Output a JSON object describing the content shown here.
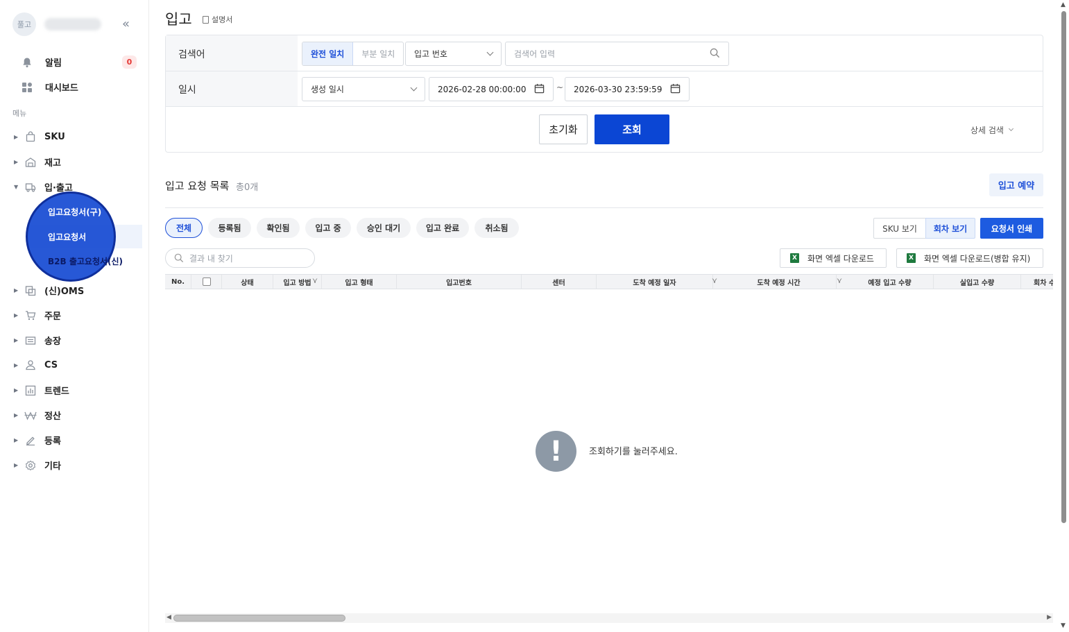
{
  "sidebar": {
    "avatar_text": "풀고",
    "collapse_icon": "«",
    "alert_label": "알림",
    "alert_count": "0",
    "dashboard_label": "대시보드",
    "menu_caption": "메뉴",
    "nav": [
      {
        "label": "SKU",
        "icon": "bag-icon"
      },
      {
        "label": "재고",
        "icon": "warehouse-icon"
      },
      {
        "label": "입·출고",
        "icon": "truck-icon"
      },
      {
        "label": "(신)OMS",
        "icon": "oms-icon"
      },
      {
        "label": "주문",
        "icon": "cart-icon"
      },
      {
        "label": "송장",
        "icon": "invoice-icon"
      },
      {
        "label": "CS",
        "icon": "person-icon"
      },
      {
        "label": "트렌드",
        "icon": "chart-icon"
      },
      {
        "label": "정산",
        "icon": "won-icon"
      },
      {
        "label": "등록",
        "icon": "pen-icon"
      },
      {
        "label": "기타",
        "icon": "gear-icon"
      }
    ],
    "sub_items": [
      "입고요청서(구)",
      "입고요청서",
      "B2B 출고요청서(신)"
    ]
  },
  "header": {
    "title": "입고",
    "manual_label": "설명서"
  },
  "search": {
    "keyword_label": "검색어",
    "mode_full": "완전 일치",
    "mode_partial": "부분 일치",
    "field_select": "입고 번호",
    "keyword_placeholder": "검색어 입력",
    "date_label": "일시",
    "date_type": "생성 일시",
    "date_from": "2026-02-28 00:00:00",
    "date_sep": "~",
    "date_to": "2026-03-30 23:59:59",
    "reset_label": "초기화",
    "search_label": "조회",
    "advanced_label": "상세 검색"
  },
  "list": {
    "title": "입고 요청 목록",
    "count": "총0개",
    "reserve_label": "입고 예약",
    "chips": [
      "전체",
      "등록됨",
      "확인됨",
      "입고 중",
      "승인 대기",
      "입고 완료",
      "취소됨"
    ],
    "view_sku": "SKU 보기",
    "view_trip": "회차 보기",
    "print_label": "요청서 인쇄",
    "find_placeholder": "결과 내 찾기",
    "excel_screen": "화면 엑셀 다운로드",
    "excel_merge": "화면 엑셀 다운로드(병합 유지)",
    "columns": [
      "No.",
      "상태",
      "입고 방법",
      "입고 형태",
      "입고번호",
      "센터",
      "도착 예정 일자",
      "도착 예정 시간",
      "예정 입고 수량",
      "실입고 수량",
      "회차 수"
    ],
    "empty_message": "조회하기를 눌러주세요."
  }
}
